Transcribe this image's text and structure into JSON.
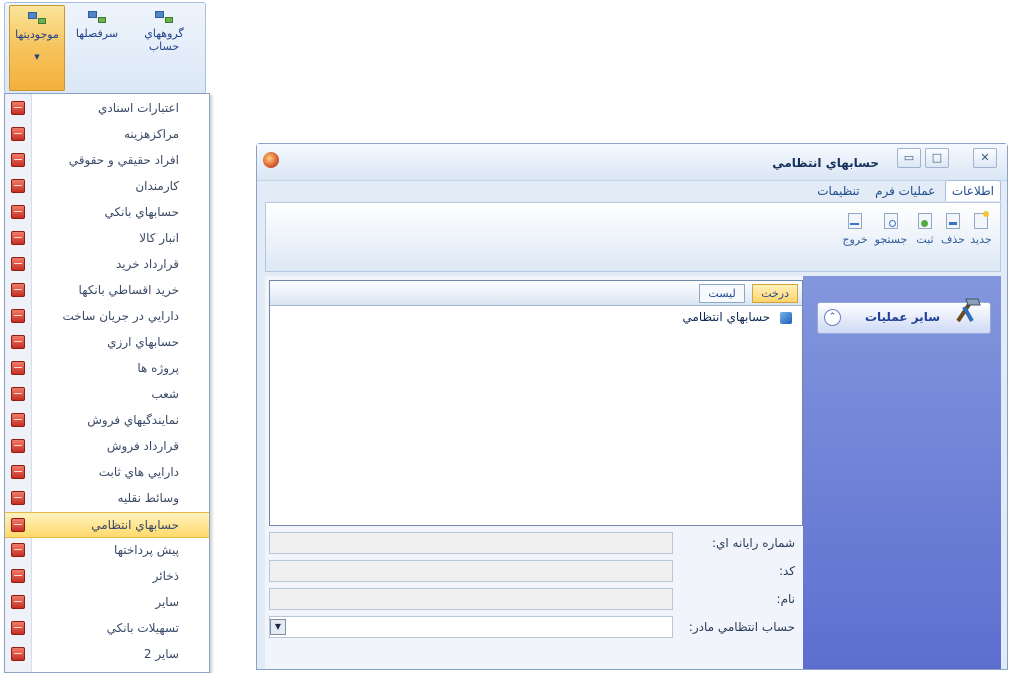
{
  "ribbon": {
    "buttons": [
      {
        "label": "موجوديتها",
        "icon": "tree-icon",
        "active": true
      },
      {
        "label": "سرفصلها",
        "icon": "tree-icon",
        "active": false
      },
      {
        "label": "گروههاي حساب",
        "icon": "tree-icon",
        "active": false
      }
    ]
  },
  "menu": {
    "items": [
      {
        "label": "اعتبارات اسنادي"
      },
      {
        "label": "مراكزهزينه"
      },
      {
        "label": "افراد حقيقي و حقوقي"
      },
      {
        "label": "كارمندان"
      },
      {
        "label": "حسابهاي بانكي"
      },
      {
        "label": "انبار كالا"
      },
      {
        "label": "قرارداد خريد"
      },
      {
        "label": "خريد اقساطي بانكها"
      },
      {
        "label": "دارايي در جريان ساخت"
      },
      {
        "label": "حسابهاي ارزي"
      },
      {
        "label": "پروژه ها"
      },
      {
        "label": "شعب"
      },
      {
        "label": "نمايندگيهاي فروش"
      },
      {
        "label": "قرارداد فروش"
      },
      {
        "label": "دارايي هاي ثابت"
      },
      {
        "label": "وسائط نقليه"
      },
      {
        "label": "حسابهاي انتظامي",
        "highlighted": true
      },
      {
        "label": "پيش پرداختها"
      },
      {
        "label": "ذخائر"
      },
      {
        "label": "ساير"
      },
      {
        "label": "تسهيلات بانكي"
      },
      {
        "label": "ساير 2"
      }
    ]
  },
  "window": {
    "title": "حسابهاي انتظامي",
    "tabs": [
      "اطلاعات",
      "عمليات فرم",
      "تنظيمات"
    ],
    "active_tab": "اطلاعات",
    "toolbar": [
      "جديد",
      "حذف",
      "ثبت",
      "جستجو",
      "خروج"
    ],
    "view_buttons": [
      "درخت",
      "ليست"
    ],
    "active_view": "درخت",
    "tree_root": "حسابهاي انتظامي",
    "side_panel": {
      "title": "ساير عمليات"
    },
    "fields": {
      "computer_number": {
        "label": "شماره رايانه اي:",
        "value": ""
      },
      "code": {
        "label": "كد:",
        "value": ""
      },
      "name": {
        "label": "نام:",
        "value": ""
      },
      "parent": {
        "label": "حساب انتظامي مادر:",
        "value": ""
      }
    }
  },
  "colors": {
    "accent": "#f6c35b",
    "side_panel": "#6b7fd6",
    "menu_icon": "#c62f22"
  }
}
